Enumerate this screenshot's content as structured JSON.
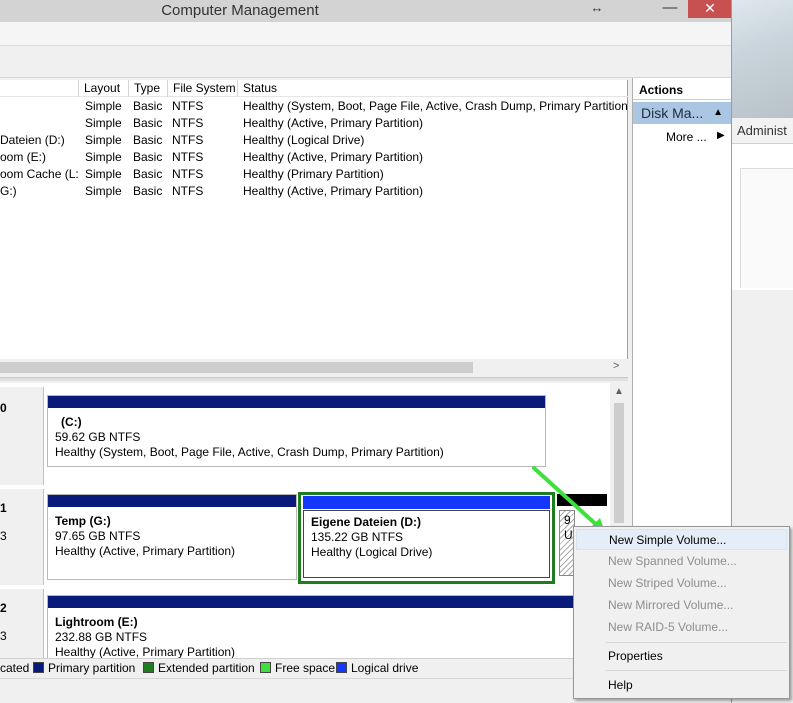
{
  "window": {
    "title": "Computer Management",
    "resize_glyph": "↔",
    "minimize_glyph": "—",
    "close_glyph": "✕"
  },
  "background_window": {
    "header_text": "Administ"
  },
  "volume_list": {
    "columns": [
      "Layout",
      "Type",
      "File System",
      "Status"
    ],
    "rows": [
      {
        "name": "",
        "layout": "Simple",
        "type": "Basic",
        "fs": "NTFS",
        "status": "Healthy (System, Boot, Page File, Active, Crash Dump, Primary Partition)"
      },
      {
        "name": "",
        "layout": "Simple",
        "type": "Basic",
        "fs": "NTFS",
        "status": "Healthy (Active, Primary Partition)"
      },
      {
        "name": "Dateien (D:)",
        "layout": "Simple",
        "type": "Basic",
        "fs": "NTFS",
        "status": "Healthy (Logical Drive)"
      },
      {
        "name": "oom (E:)",
        "layout": "Simple",
        "type": "Basic",
        "fs": "NTFS",
        "status": "Healthy (Active, Primary Partition)"
      },
      {
        "name": "oom Cache (L:)",
        "layout": "Simple",
        "type": "Basic",
        "fs": "NTFS",
        "status": "Healthy (Primary Partition)"
      },
      {
        "name": "G:)",
        "layout": "Simple",
        "type": "Basic",
        "fs": "NTFS",
        "status": "Healthy (Active, Primary Partition)"
      }
    ],
    "scroll_right_glyph": ">"
  },
  "actions": {
    "title": "Actions",
    "section": "Disk Ma...",
    "section_glyph": "▲",
    "more": "More ...",
    "more_glyph": "▶"
  },
  "disks": {
    "labels": [
      "0",
      "1",
      "3",
      "2",
      "3"
    ],
    "disk0": {
      "c_drive": {
        "name": "(C:)",
        "size": "59.62 GB NTFS",
        "status": "Healthy (System, Boot, Page File, Active, Crash Dump, Primary Partition)"
      }
    },
    "disk1": {
      "temp": {
        "name": "Temp  (G:)",
        "size": "97.65 GB NTFS",
        "status": "Healthy (Active, Primary Partition)"
      },
      "eigene": {
        "name": "Eigene Dateien  (D:)",
        "size": "135.22 GB NTFS",
        "status": "Healthy (Logical Drive)"
      },
      "free_line1": "9",
      "free_line2": "U"
    },
    "disk2": {
      "lightroom": {
        "name": "Lightroom  (E:)",
        "size": "232.88 GB NTFS",
        "status": "Healthy (Active, Primary Partition)"
      }
    }
  },
  "legend": {
    "items": [
      {
        "label": "cated",
        "color": "#000000"
      },
      {
        "label": "Primary partition",
        "color": "#0a1a7a"
      },
      {
        "label": "Extended partition",
        "color": "#1e7d1e"
      },
      {
        "label": "Free space",
        "color": "#3ee03e"
      },
      {
        "label": "Logical drive",
        "color": "#1437ff"
      }
    ]
  },
  "context_menu": {
    "items": [
      {
        "label": "New Simple Volume...",
        "enabled": true
      },
      {
        "label": "New Spanned Volume...",
        "enabled": false
      },
      {
        "label": "New Striped Volume...",
        "enabled": false
      },
      {
        "label": "New Mirrored Volume...",
        "enabled": false
      },
      {
        "label": "New RAID-5 Volume...",
        "enabled": false
      },
      {
        "label": "Properties",
        "enabled": true
      },
      {
        "label": "Help",
        "enabled": true
      }
    ]
  },
  "colors": {
    "primary_bar": "#0a1a7a",
    "logical_bar": "#1437ff",
    "extended_border": "#1e7d1e",
    "annotation_arrow": "#3ee03e",
    "actions_section": "#abc6e3"
  }
}
